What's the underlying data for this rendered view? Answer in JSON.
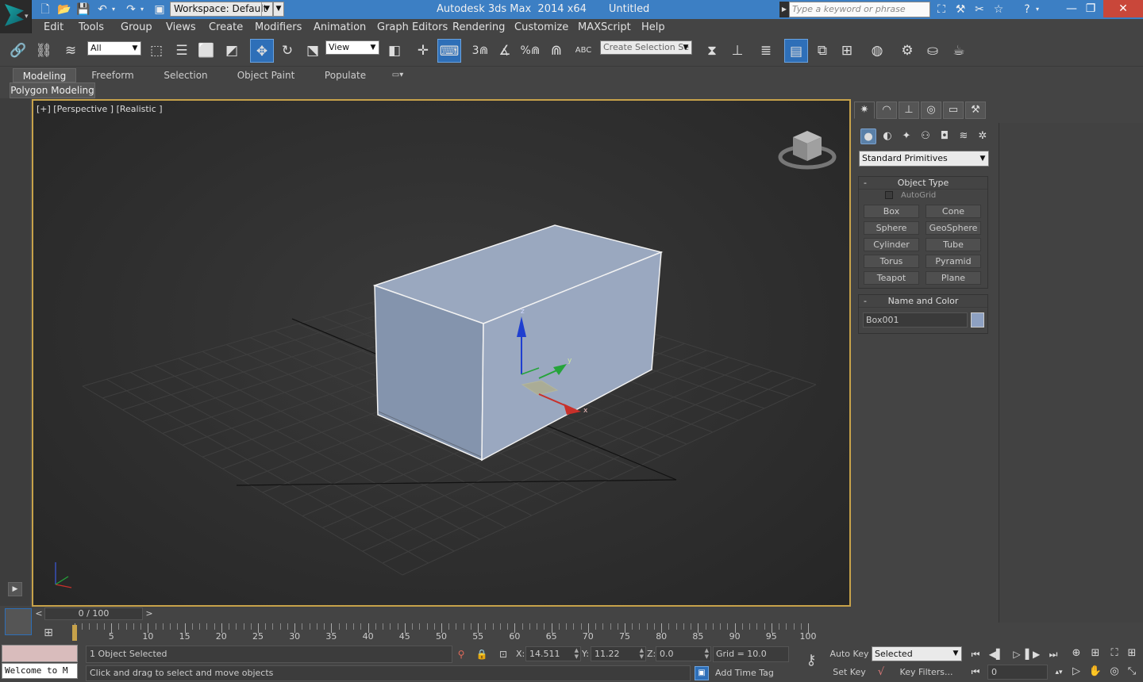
{
  "window": {
    "app_title": "Autodesk 3ds Max  2014 x64",
    "doc_title": "Untitled",
    "workspace": "Workspace: Default",
    "search_placeholder": "Type a keyword or phrase"
  },
  "menu": [
    "Edit",
    "Tools",
    "Group",
    "Views",
    "Create",
    "Modifiers",
    "Animation",
    "Graph Editors",
    "Rendering",
    "Customize",
    "MAXScript",
    "Help"
  ],
  "toolbar": {
    "selection_filter": "All",
    "ref_coord": "View",
    "named_selection_placeholder": "Create Selection Se",
    "snap_label": "3",
    "percent_label": "%",
    "abc_label": "ABC"
  },
  "ribbon": {
    "tabs": [
      "Modeling",
      "Freeform",
      "Selection",
      "Object Paint",
      "Populate"
    ],
    "active_tab": "Modeling",
    "panel": "Polygon Modeling"
  },
  "viewport": {
    "label": "[+] [Perspective ] [Realistic ]",
    "gizmo_axes": {
      "x": "x",
      "y": "y",
      "z": "z"
    }
  },
  "command_panel": {
    "category": "Standard Primitives",
    "object_type_title": "Object Type",
    "autogrid": "AutoGrid",
    "buttons": [
      "Box",
      "Cone",
      "Sphere",
      "GeoSphere",
      "Cylinder",
      "Tube",
      "Torus",
      "Pyramid",
      "Teapot",
      "Plane"
    ],
    "name_color_title": "Name and Color",
    "object_name": "Box001",
    "rollout_toggle": "-",
    "object_color": "#8ea1c2"
  },
  "timeline": {
    "frame_display": "0 / 100",
    "ticks": [
      "5",
      "10",
      "15",
      "20",
      "25",
      "30",
      "35",
      "40",
      "45",
      "50",
      "55",
      "60",
      "65",
      "70",
      "75",
      "80",
      "85",
      "90",
      "95",
      "100"
    ]
  },
  "status": {
    "welcome": "Welcome to M",
    "selection_info": "1 Object Selected",
    "prompt": "Click and drag to select and move objects",
    "x_label": "X:",
    "x_value": "14.511",
    "y_label": "Y:",
    "y_value": "11.22",
    "z_label": "Z:",
    "z_value": "0.0",
    "grid": "Grid = 10.0",
    "add_time_tag": "Add Time Tag",
    "auto_key": "Auto Key",
    "set_key": "Set Key",
    "key_mode": "Selected",
    "key_filters": "Key Filters...",
    "current_frame": "0"
  },
  "colors": {
    "title_bar": "#3c7fc4",
    "viewport_border": "#c7a24a",
    "active_tool": "#2e6fb8"
  }
}
